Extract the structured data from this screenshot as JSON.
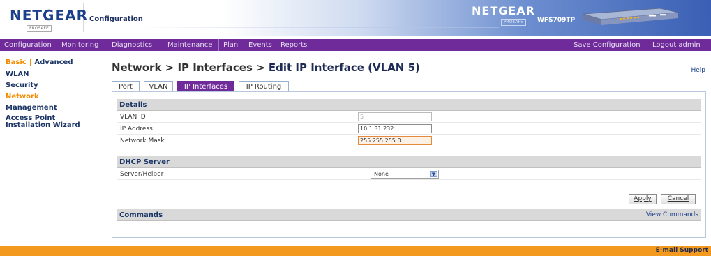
{
  "header": {
    "logo": "NETGEAR",
    "logo_sub": "PROSAFE",
    "title": "Configuration",
    "brand": "NETGEAR",
    "brand_sub": "PROSAFE",
    "model": "WFS709TP"
  },
  "nav": {
    "items": [
      {
        "label": "Configuration"
      },
      {
        "label": "Monitoring"
      },
      {
        "label": "Diagnostics"
      },
      {
        "label": "Maintenance"
      },
      {
        "label": "Plan"
      },
      {
        "label": "Events"
      },
      {
        "label": "Reports"
      }
    ],
    "save": "Save Configuration",
    "logout": "Logout admin"
  },
  "sidebar": {
    "basic": "Basic",
    "separator": "|",
    "advanced": "Advanced",
    "items": [
      {
        "label": "WLAN"
      },
      {
        "label": "Security"
      },
      {
        "label": "Network"
      },
      {
        "label": "Management"
      },
      {
        "label": "Access Point Installation Wizard"
      }
    ]
  },
  "main": {
    "breadcrumb_prefix": "Network > IP Interfaces > ",
    "breadcrumb_current": "Edit IP Interface (VLAN 5)",
    "help": "Help",
    "tabs": [
      {
        "label": "Port"
      },
      {
        "label": "VLAN"
      },
      {
        "label": "IP Interfaces"
      },
      {
        "label": "IP Routing"
      }
    ],
    "active_tab": "IP Interfaces"
  },
  "details": {
    "heading": "Details",
    "vlan_id_label": "VLAN ID",
    "vlan_id_value": "5",
    "ip_label": "IP Address",
    "ip_value": "10.1.31.232",
    "mask_label": "Network Mask",
    "mask_value": "255.255.255.0"
  },
  "dhcp": {
    "heading": "DHCP Server",
    "label": "Server/Helper",
    "selected": "None"
  },
  "actions": {
    "apply": "Apply",
    "cancel": "Cancel"
  },
  "commands": {
    "heading": "Commands",
    "link": "View Commands"
  },
  "footer": {
    "email": "E-mail Support"
  },
  "colors": {
    "accent_purple": "#6f2b9a",
    "accent_orange": "#f39a1e",
    "link_blue": "#1c3f8c"
  }
}
